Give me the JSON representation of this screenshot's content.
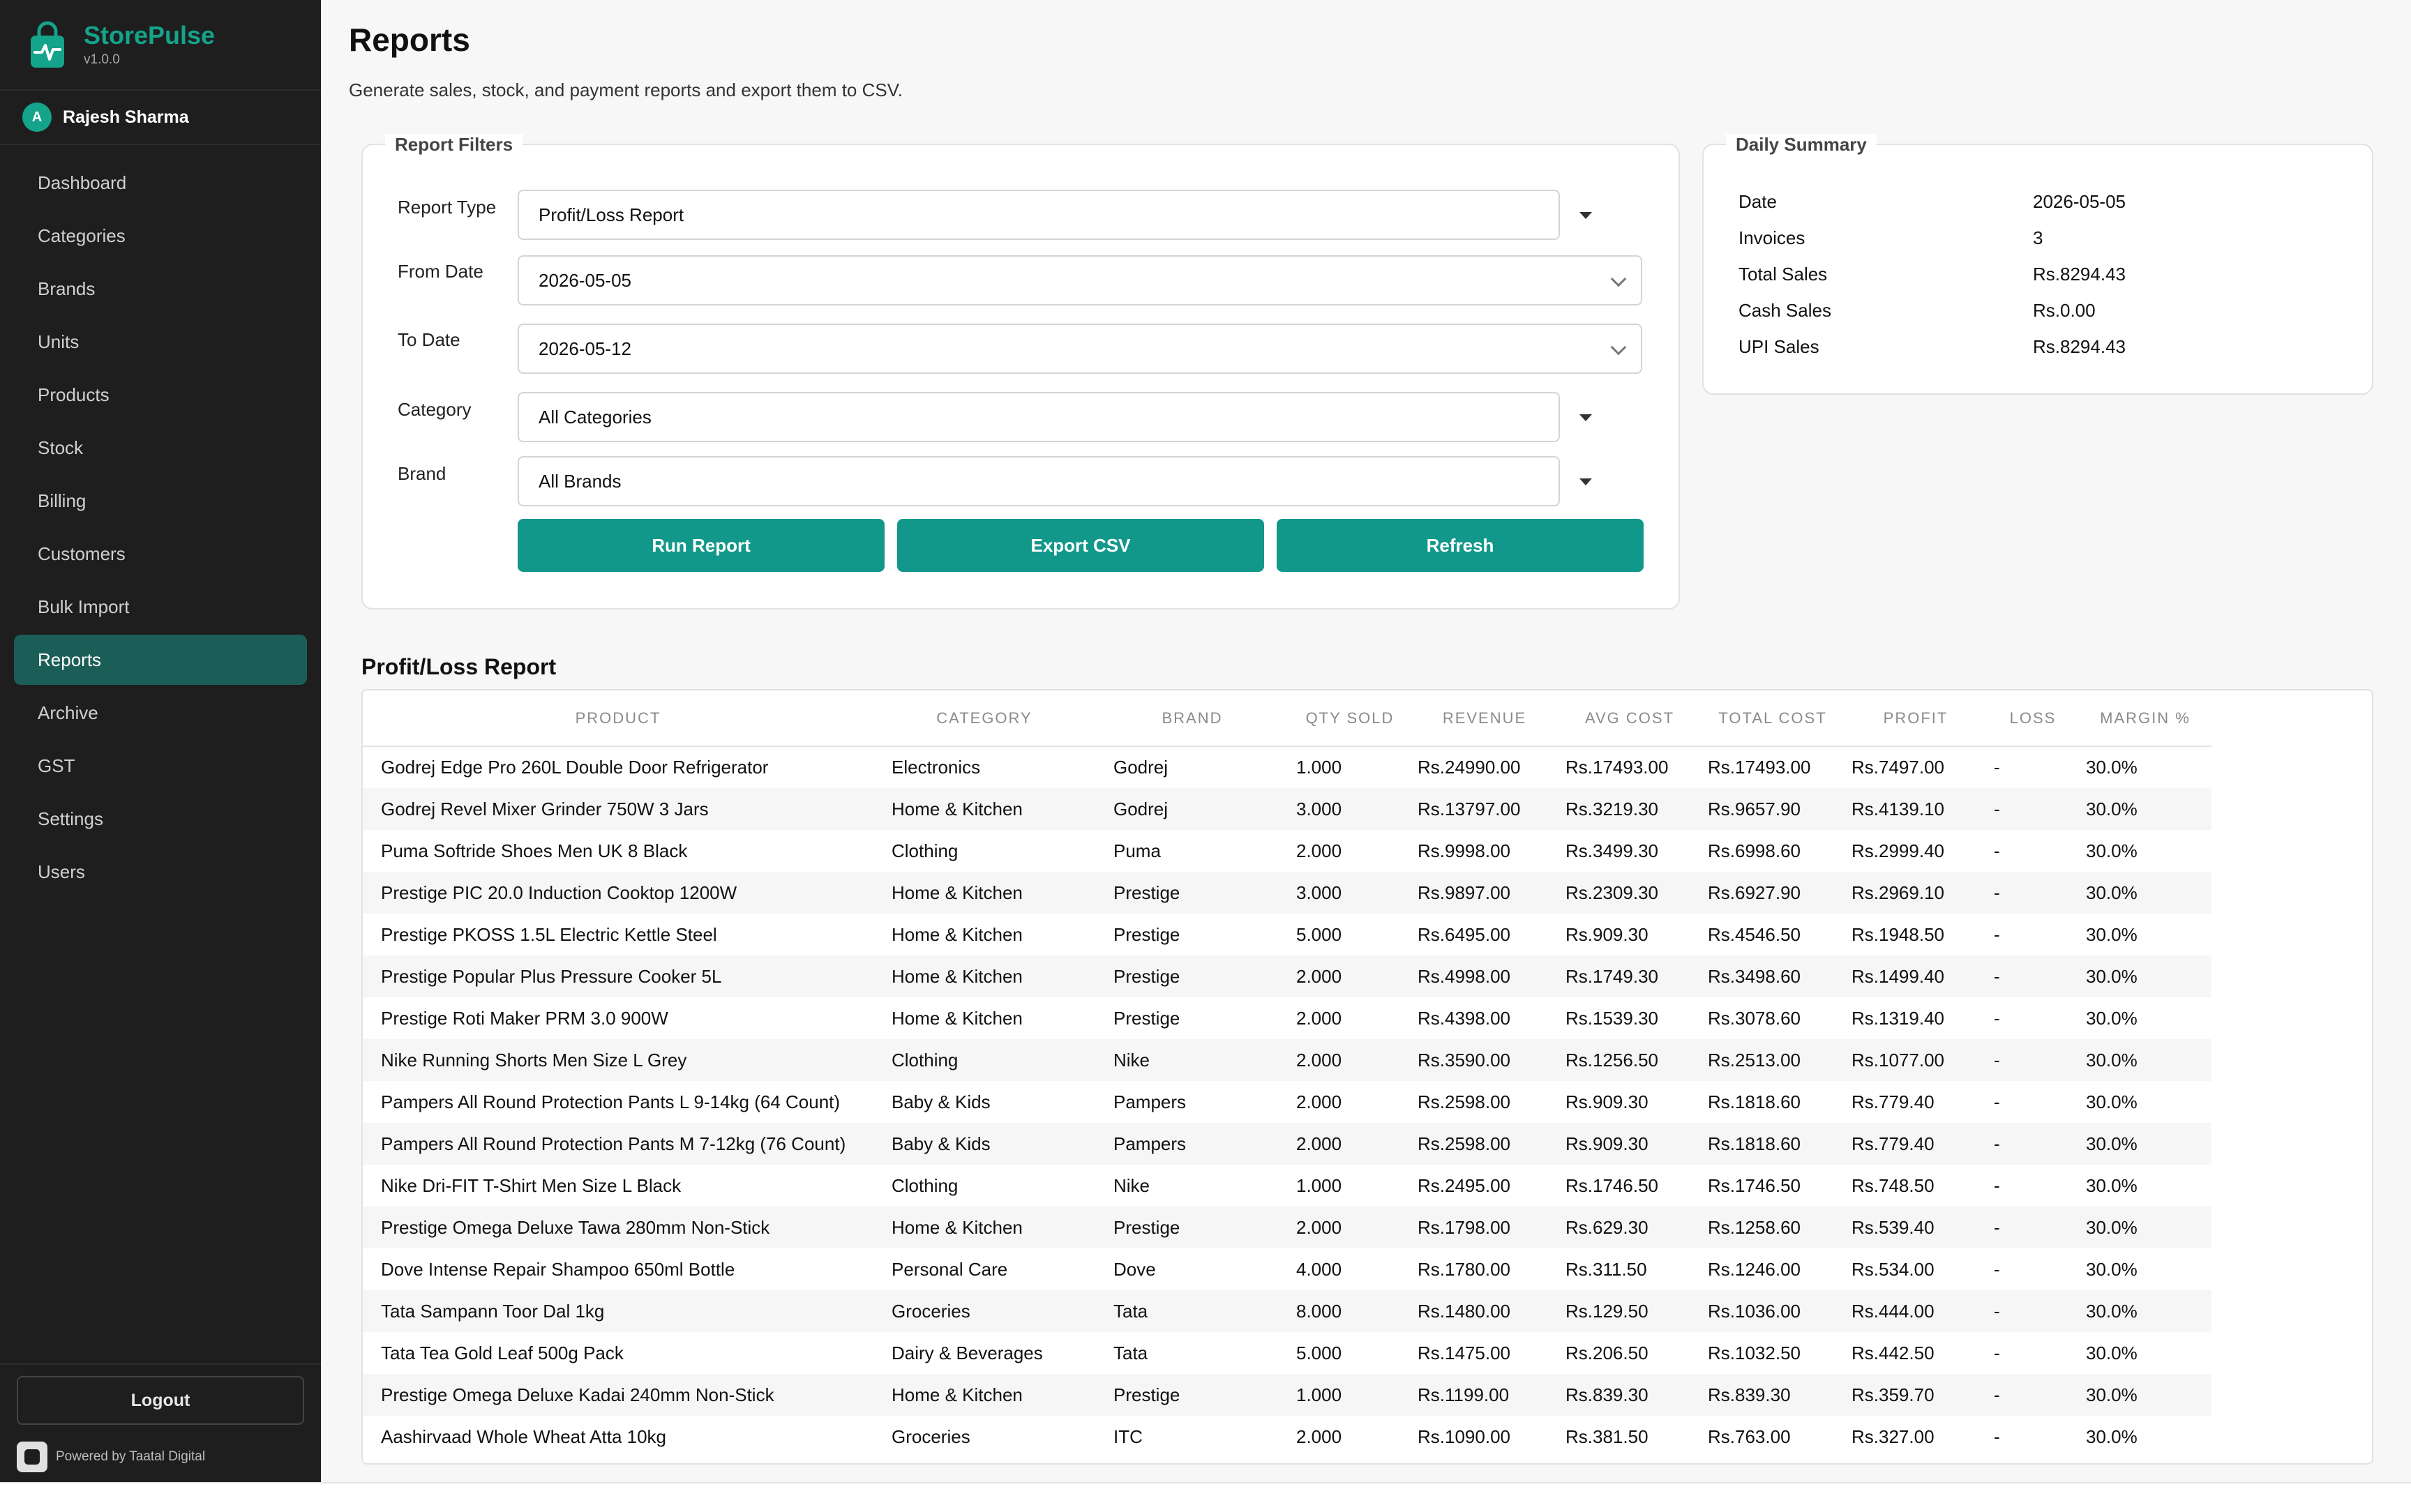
{
  "app": {
    "name": "StorePulse",
    "version": "v1.0.0"
  },
  "user": {
    "initial": "A",
    "name": "Rajesh Sharma"
  },
  "sidebar": {
    "items": [
      {
        "label": "Dashboard"
      },
      {
        "label": "Categories"
      },
      {
        "label": "Brands"
      },
      {
        "label": "Units"
      },
      {
        "label": "Products"
      },
      {
        "label": "Stock"
      },
      {
        "label": "Billing"
      },
      {
        "label": "Customers"
      },
      {
        "label": "Bulk Import"
      },
      {
        "label": "Reports"
      },
      {
        "label": "Archive"
      },
      {
        "label": "GST"
      },
      {
        "label": "Settings"
      },
      {
        "label": "Users"
      }
    ],
    "active": "Reports",
    "logout_label": "Logout",
    "powered_by": "Powered by Taatal Digital"
  },
  "page": {
    "title": "Reports",
    "subtitle": "Generate sales, stock, and payment reports and export them to CSV."
  },
  "filters": {
    "legend": "Report Filters",
    "report_type_label": "Report Type",
    "report_type_value": "Profit/Loss Report",
    "from_date_label": "From Date",
    "from_date_value": "2026-05-05",
    "to_date_label": "To Date",
    "to_date_value": "2026-05-12",
    "category_label": "Category",
    "category_value": "All Categories",
    "brand_label": "Brand",
    "brand_value": "All Brands",
    "run_label": "Run Report",
    "export_label": "Export CSV",
    "refresh_label": "Refresh"
  },
  "summary": {
    "legend": "Daily Summary",
    "rows": [
      {
        "label": "Date",
        "value": "2026-05-05"
      },
      {
        "label": "Invoices",
        "value": "3"
      },
      {
        "label": "Total Sales",
        "value": "Rs.8294.43"
      },
      {
        "label": "Cash Sales",
        "value": "Rs.0.00"
      },
      {
        "label": "UPI Sales",
        "value": "Rs.8294.43"
      }
    ]
  },
  "report": {
    "title": "Profit/Loss Report",
    "columns": [
      "PRODUCT",
      "CATEGORY",
      "BRAND",
      "QTY SOLD",
      "REVENUE",
      "AVG COST",
      "TOTAL COST",
      "PROFIT",
      "LOSS",
      "MARGIN %"
    ],
    "rows": [
      [
        "Godrej Edge Pro 260L Double Door Refrigerator",
        "Electronics",
        "Godrej",
        "1.000",
        "Rs.24990.00",
        "Rs.17493.00",
        "Rs.17493.00",
        "Rs.7497.00",
        "-",
        "30.0%"
      ],
      [
        "Godrej Revel Mixer Grinder 750W 3 Jars",
        "Home & Kitchen",
        "Godrej",
        "3.000",
        "Rs.13797.00",
        "Rs.3219.30",
        "Rs.9657.90",
        "Rs.4139.10",
        "-",
        "30.0%"
      ],
      [
        "Puma Softride Shoes Men UK 8 Black",
        "Clothing",
        "Puma",
        "2.000",
        "Rs.9998.00",
        "Rs.3499.30",
        "Rs.6998.60",
        "Rs.2999.40",
        "-",
        "30.0%"
      ],
      [
        "Prestige PIC 20.0 Induction Cooktop 1200W",
        "Home & Kitchen",
        "Prestige",
        "3.000",
        "Rs.9897.00",
        "Rs.2309.30",
        "Rs.6927.90",
        "Rs.2969.10",
        "-",
        "30.0%"
      ],
      [
        "Prestige PKOSS 1.5L Electric Kettle Steel",
        "Home & Kitchen",
        "Prestige",
        "5.000",
        "Rs.6495.00",
        "Rs.909.30",
        "Rs.4546.50",
        "Rs.1948.50",
        "-",
        "30.0%"
      ],
      [
        "Prestige Popular Plus Pressure Cooker 5L",
        "Home & Kitchen",
        "Prestige",
        "2.000",
        "Rs.4998.00",
        "Rs.1749.30",
        "Rs.3498.60",
        "Rs.1499.40",
        "-",
        "30.0%"
      ],
      [
        "Prestige Roti Maker PRM 3.0 900W",
        "Home & Kitchen",
        "Prestige",
        "2.000",
        "Rs.4398.00",
        "Rs.1539.30",
        "Rs.3078.60",
        "Rs.1319.40",
        "-",
        "30.0%"
      ],
      [
        "Nike Running Shorts Men Size L Grey",
        "Clothing",
        "Nike",
        "2.000",
        "Rs.3590.00",
        "Rs.1256.50",
        "Rs.2513.00",
        "Rs.1077.00",
        "-",
        "30.0%"
      ],
      [
        "Pampers All Round Protection Pants L 9-14kg (64 Count)",
        "Baby & Kids",
        "Pampers",
        "2.000",
        "Rs.2598.00",
        "Rs.909.30",
        "Rs.1818.60",
        "Rs.779.40",
        "-",
        "30.0%"
      ],
      [
        "Pampers All Round Protection Pants M 7-12kg (76 Count)",
        "Baby & Kids",
        "Pampers",
        "2.000",
        "Rs.2598.00",
        "Rs.909.30",
        "Rs.1818.60",
        "Rs.779.40",
        "-",
        "30.0%"
      ],
      [
        "Nike Dri-FIT T-Shirt Men Size L Black",
        "Clothing",
        "Nike",
        "1.000",
        "Rs.2495.00",
        "Rs.1746.50",
        "Rs.1746.50",
        "Rs.748.50",
        "-",
        "30.0%"
      ],
      [
        "Prestige Omega Deluxe Tawa 280mm Non-Stick",
        "Home & Kitchen",
        "Prestige",
        "2.000",
        "Rs.1798.00",
        "Rs.629.30",
        "Rs.1258.60",
        "Rs.539.40",
        "-",
        "30.0%"
      ],
      [
        "Dove Intense Repair Shampoo 650ml Bottle",
        "Personal Care",
        "Dove",
        "4.000",
        "Rs.1780.00",
        "Rs.311.50",
        "Rs.1246.00",
        "Rs.534.00",
        "-",
        "30.0%"
      ],
      [
        "Tata Sampann Toor Dal 1kg",
        "Groceries",
        "Tata",
        "8.000",
        "Rs.1480.00",
        "Rs.129.50",
        "Rs.1036.00",
        "Rs.444.00",
        "-",
        "30.0%"
      ],
      [
        "Tata Tea Gold Leaf 500g Pack",
        "Dairy & Beverages",
        "Tata",
        "5.000",
        "Rs.1475.00",
        "Rs.206.50",
        "Rs.1032.50",
        "Rs.442.50",
        "-",
        "30.0%"
      ],
      [
        "Prestige Omega Deluxe Kadai 240mm Non-Stick",
        "Home & Kitchen",
        "Prestige",
        "1.000",
        "Rs.1199.00",
        "Rs.839.30",
        "Rs.839.30",
        "Rs.359.70",
        "-",
        "30.0%"
      ],
      [
        "Aashirvaad Whole Wheat Atta 10kg",
        "Groceries",
        "ITC",
        "2.000",
        "Rs.1090.00",
        "Rs.381.50",
        "Rs.763.00",
        "Rs.327.00",
        "-",
        "30.0%"
      ]
    ]
  },
  "colors": {
    "accent": "#14a38b",
    "button": "#12988a",
    "sidebar_bg": "#1e1e1e",
    "active_nav": "#1b5e57"
  },
  "icons": {
    "logo": "shopping-bag-pulse-icon",
    "powered": "taatal-logo-icon",
    "dropdown": "caret-down-icon",
    "date": "chevron-down-icon"
  }
}
